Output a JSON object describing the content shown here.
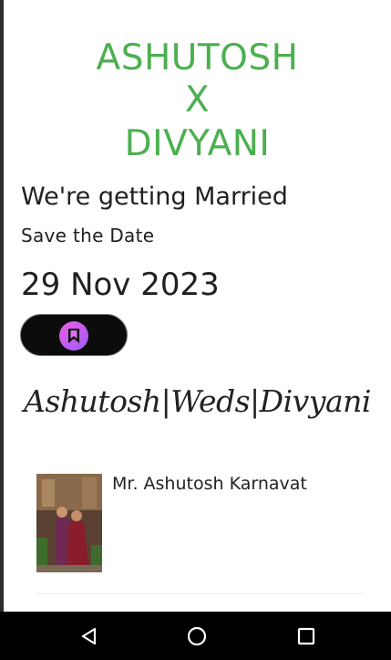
{
  "header": {
    "line1": "ASHUTOSH",
    "line2": "X",
    "line3": "DIVYANI"
  },
  "intro": {
    "heading": "We're getting Married",
    "subheading": "Save the Date",
    "date": "29 Nov 2023"
  },
  "save_button": {
    "icon": "bookmark-icon"
  },
  "banner": {
    "text": "Ashutosh|Weds|Divyani"
  },
  "person": {
    "name": "Mr. Ashutosh Karnavat"
  },
  "navigation": {
    "back_icon": "back-triangle-icon",
    "home_icon": "home-circle-icon",
    "recents_icon": "recents-square-icon"
  },
  "colors": {
    "accent": "#4caf50",
    "pill_gradient_start": "#ef5de0",
    "pill_gradient_end": "#9b5cff"
  }
}
